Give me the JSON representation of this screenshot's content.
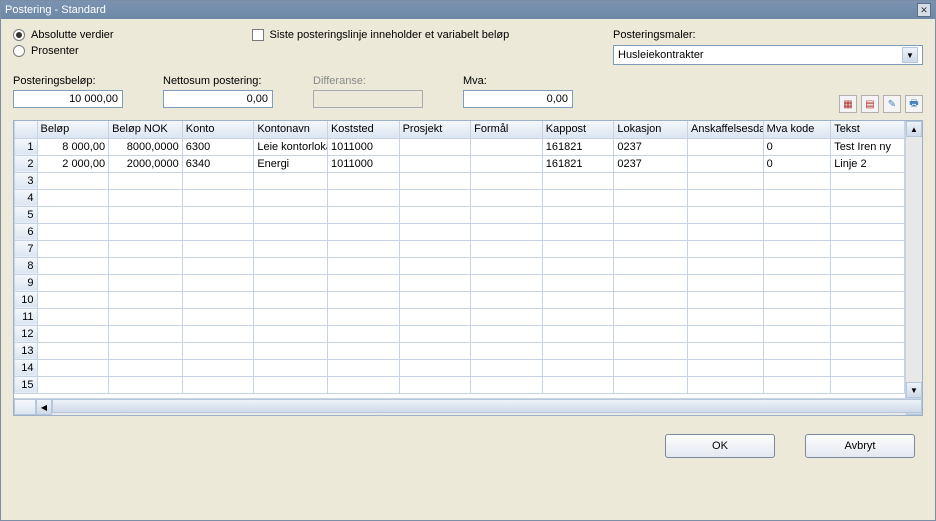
{
  "window": {
    "title": "Postering - Standard"
  },
  "options": {
    "radio1": "Absolutte verdier",
    "radio2": "Prosenter",
    "radio_selected": 1,
    "checkbox_label": "Siste posteringslinje inneholder et variabelt beløp"
  },
  "maler": {
    "label": "Posteringsmaler:",
    "selected": "Husleiekontrakter"
  },
  "sums": {
    "posteringsbelop": {
      "label": "Posteringsbeløp:",
      "value": "10 000,00"
    },
    "nettosum": {
      "label": "Nettosum postering:",
      "value": "0,00"
    },
    "differanse": {
      "label": "Differanse:",
      "value": ""
    },
    "mva": {
      "label": "Mva:",
      "value": "0,00"
    }
  },
  "grid": {
    "columns": [
      "Beløp",
      "Beløp NOK",
      "Konto",
      "Kontonavn",
      "Koststed",
      "Prosjekt",
      "Formål",
      "Kappost",
      "Lokasjon",
      "Anskaffelsesdato",
      "Mva kode",
      "Tekst"
    ],
    "rows": [
      {
        "n": "1",
        "belop": "8 000,00",
        "beloknok": "8000,0000",
        "konto": "6300",
        "kontonavn": "Leie kontorlokale",
        "koststed": "1011000",
        "prosjekt": "",
        "formal": "",
        "kappost": "161821",
        "lokasjon": "0237",
        "ansk": "",
        "mva": "0",
        "tekst": "Test Iren ny"
      },
      {
        "n": "2",
        "belop": "2 000,00",
        "beloknok": "2000,0000",
        "konto": "6340",
        "kontonavn": "Energi",
        "koststed": "1011000",
        "prosjekt": "",
        "formal": "",
        "kappost": "161821",
        "lokasjon": "0237",
        "ansk": "",
        "mva": "0",
        "tekst": "Linje 2"
      }
    ],
    "empty_rows": [
      "3",
      "4",
      "5",
      "6",
      "7",
      "8",
      "9",
      "10",
      "11",
      "12",
      "13",
      "14",
      "15"
    ]
  },
  "icons": {
    "i1": "table-icon",
    "i2": "grid-icon",
    "i3": "clear-icon",
    "i4": "print-icon"
  },
  "buttons": {
    "ok": "OK",
    "cancel": "Avbryt"
  },
  "colors": {
    "accent": "#7f9db9"
  }
}
